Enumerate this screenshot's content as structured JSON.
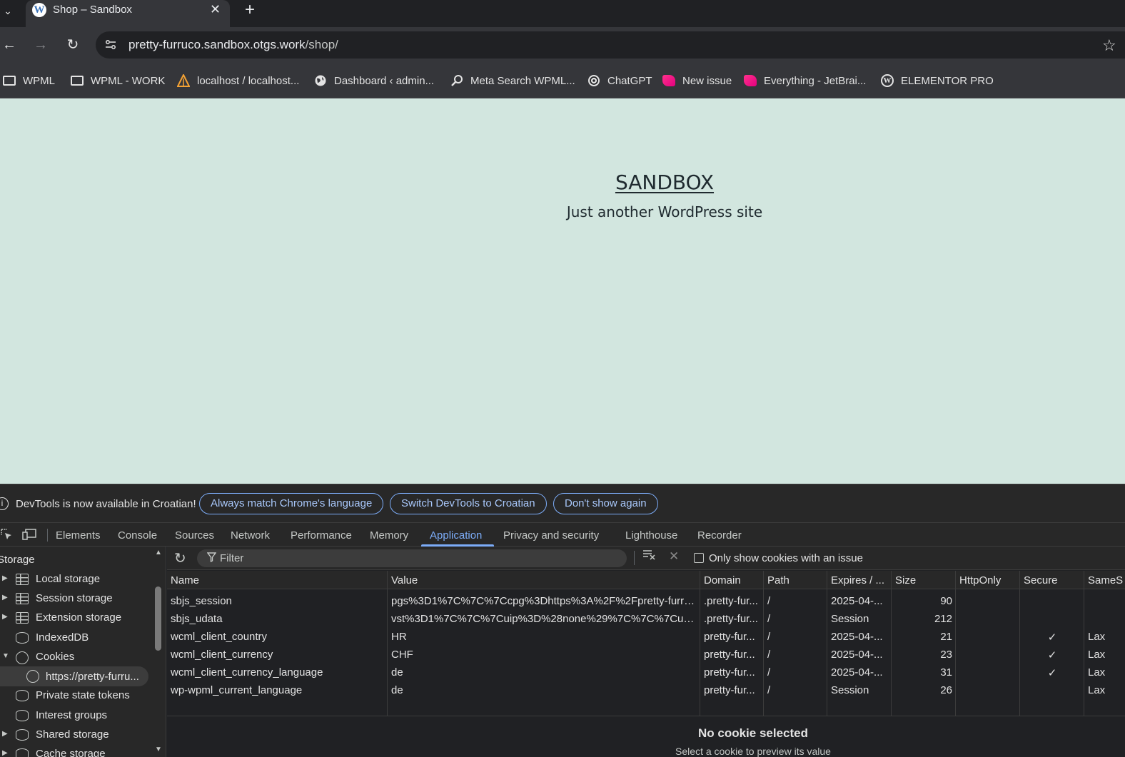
{
  "browser": {
    "tab": {
      "title": "Shop – Sandbox",
      "favicon": "wordpress-icon"
    },
    "url": {
      "host": "pretty-furruco.sandbox.otgs.work",
      "path": "/shop/"
    },
    "bookmarks": [
      {
        "label": "WPML",
        "icon": "folder-icon"
      },
      {
        "label": "WPML - WORK",
        "icon": "folder-icon"
      },
      {
        "label": "localhost / localhost...",
        "icon": "phpmyadmin-icon"
      },
      {
        "label": "Dashboard ‹ admin...",
        "icon": "globe-icon"
      },
      {
        "label": "Meta Search WPML...",
        "icon": "magnifier-icon"
      },
      {
        "label": "ChatGPT",
        "icon": "chatgpt-icon"
      },
      {
        "label": "New issue",
        "icon": "jetbrains-icon"
      },
      {
        "label": "Everything - JetBrai...",
        "icon": "jetbrains-icon"
      },
      {
        "label": "ELEMENTOR PRO",
        "icon": "wordpress-icon"
      }
    ]
  },
  "page": {
    "site_title": "SANDBOX",
    "tagline": "Just another WordPress site"
  },
  "devtools": {
    "infobar": {
      "text": "DevTools is now available in Croatian!",
      "buttons": [
        "Always match Chrome's language",
        "Switch DevTools to Croatian",
        "Don't show again"
      ]
    },
    "tabs": [
      {
        "label": "Elements"
      },
      {
        "label": "Console"
      },
      {
        "label": "Sources"
      },
      {
        "label": "Network"
      },
      {
        "label": "Performance"
      },
      {
        "label": "Memory"
      },
      {
        "label": "Application",
        "active": true
      },
      {
        "label": "Privacy and security"
      },
      {
        "label": "Lighthouse"
      },
      {
        "label": "Recorder"
      }
    ],
    "sidebar": {
      "section": "Storage",
      "items": [
        {
          "label": "Local storage",
          "icon": "grid-icon",
          "expandable": true
        },
        {
          "label": "Session storage",
          "icon": "grid-icon",
          "expandable": true
        },
        {
          "label": "Extension storage",
          "icon": "grid-icon",
          "expandable": true
        },
        {
          "label": "IndexedDB",
          "icon": "database-icon",
          "expandable": false
        },
        {
          "label": "Cookies",
          "icon": "cookie-icon",
          "expanded": true
        },
        {
          "label": "https://pretty-furru...",
          "icon": "cookie-icon",
          "selected": true
        },
        {
          "label": "Private state tokens",
          "icon": "database-icon",
          "expandable": false
        },
        {
          "label": "Interest groups",
          "icon": "database-icon",
          "expandable": false
        },
        {
          "label": "Shared storage",
          "icon": "database-icon",
          "expandable": true
        },
        {
          "label": "Cache storage",
          "icon": "database-icon",
          "expandable": true
        }
      ]
    },
    "cookies_toolbar": {
      "filter_placeholder": "Filter",
      "only_issues_label": "Only show cookies with an issue",
      "only_issues_checked": false
    },
    "table": {
      "columns": [
        "Name",
        "Value",
        "Domain",
        "Path",
        "Expires / ...",
        "Size",
        "HttpOnly",
        "Secure",
        "SameS"
      ],
      "rows": [
        {
          "name": "sbjs_session",
          "value": "pgs%3D1%7C%7C%7Ccpg%3Dhttps%3A%2F%2Fpretty-furruc...",
          "domain": ".pretty-fur...",
          "path": "/",
          "expires": "2025-04-...",
          "size": "90",
          "httponly": "",
          "secure": "",
          "samesite": ""
        },
        {
          "name": "sbjs_udata",
          "value": "vst%3D1%7C%7C%7Cuip%3D%28none%29%7C%7C%7Cuag%...",
          "domain": ".pretty-fur...",
          "path": "/",
          "expires": "Session",
          "size": "212",
          "httponly": "",
          "secure": "",
          "samesite": ""
        },
        {
          "name": "wcml_client_country",
          "value": "HR",
          "domain": "pretty-fur...",
          "path": "/",
          "expires": "2025-04-...",
          "size": "21",
          "httponly": "",
          "secure": "✓",
          "samesite": "Lax"
        },
        {
          "name": "wcml_client_currency",
          "value": "CHF",
          "domain": "pretty-fur...",
          "path": "/",
          "expires": "2025-04-...",
          "size": "23",
          "httponly": "",
          "secure": "✓",
          "samesite": "Lax"
        },
        {
          "name": "wcml_client_currency_language",
          "value": "de",
          "domain": "pretty-fur...",
          "path": "/",
          "expires": "2025-04-...",
          "size": "31",
          "httponly": "",
          "secure": "✓",
          "samesite": "Lax"
        },
        {
          "name": "wp-wpml_current_language",
          "value": "de",
          "domain": "pretty-fur...",
          "path": "/",
          "expires": "Session",
          "size": "26",
          "httponly": "",
          "secure": "",
          "samesite": "Lax"
        }
      ]
    },
    "preview": {
      "title": "No cookie selected",
      "subtitle": "Select a cookie to preview its value"
    }
  }
}
